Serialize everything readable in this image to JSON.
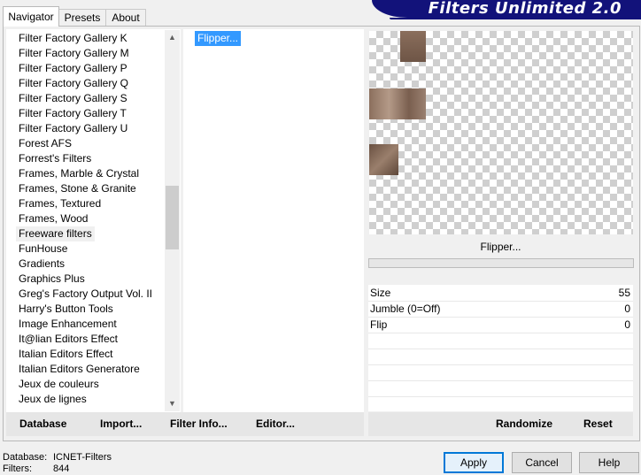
{
  "tabs": [
    {
      "label": "Navigator",
      "active": true
    },
    {
      "label": "Presets",
      "active": false
    },
    {
      "label": "About",
      "active": false
    }
  ],
  "banner": {
    "title": "Filters Unlimited 2.0",
    "color": "#12127a"
  },
  "categories": [
    "Filter Factory Gallery K",
    "Filter Factory Gallery M",
    "Filter Factory Gallery P",
    "Filter Factory Gallery Q",
    "Filter Factory Gallery S",
    "Filter Factory Gallery T",
    "Filter Factory Gallery U",
    "Forest AFS",
    "Forrest's Filters",
    "Frames, Marble & Crystal",
    "Frames, Stone & Granite",
    "Frames, Textured",
    "Frames, Wood",
    "Freeware filters",
    "FunHouse",
    "Gradients",
    "Graphics Plus",
    "Greg's Factory Output Vol. II",
    "Harry's Button Tools",
    "Image Enhancement",
    "It@lian Editors Effect",
    "Italian Editors Effect",
    "Italian Editors Generatore",
    "Jeux de couleurs",
    "Jeux de lignes"
  ],
  "selected_category": "Freeware filters",
  "filters": [
    {
      "label": "Flipper...",
      "selected": true
    }
  ],
  "left_toolbar": {
    "database": "Database",
    "import": "Import...",
    "filter_info": "Filter Info...",
    "editor": "Editor..."
  },
  "preview": {
    "filter_name": "Flipper..."
  },
  "params": [
    {
      "label": "Size",
      "value": "55"
    },
    {
      "label": "Jumble (0=Off)",
      "value": "0"
    },
    {
      "label": "Flip",
      "value": "0"
    }
  ],
  "right_toolbar": {
    "randomize": "Randomize",
    "reset": "Reset"
  },
  "status": {
    "database_label": "Database:",
    "database_value": "ICNET-Filters",
    "filters_label": "Filters:",
    "filters_value": "844"
  },
  "buttons": {
    "apply": "Apply",
    "cancel": "Cancel",
    "help": "Help"
  },
  "icons": {
    "scroll_up": "chevron-up-icon",
    "scroll_down": "chevron-down-icon"
  }
}
